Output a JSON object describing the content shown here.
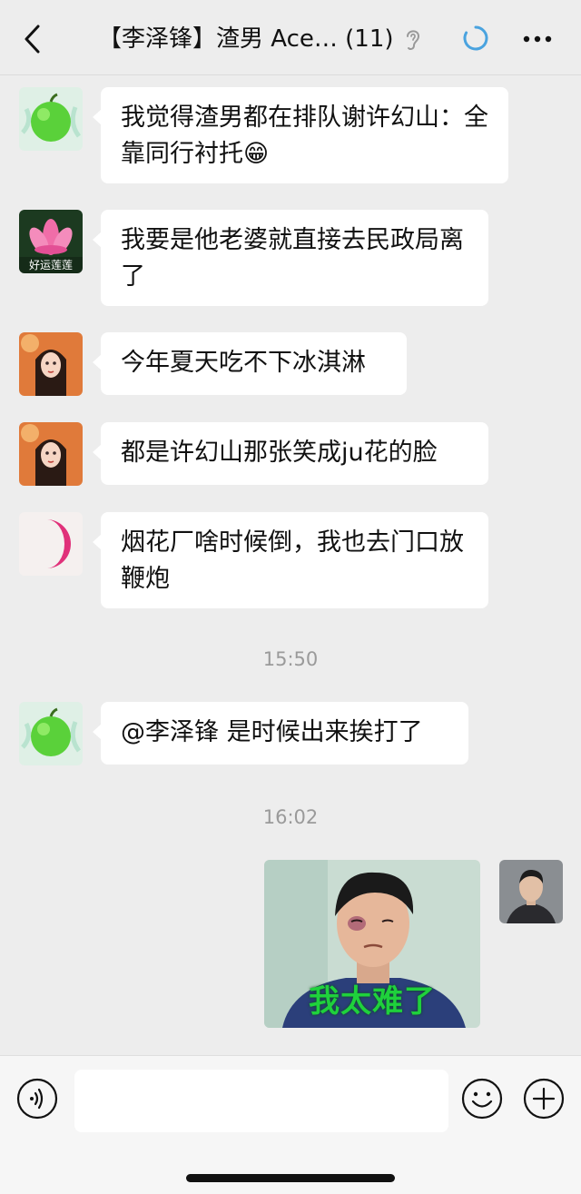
{
  "header": {
    "title": "【李泽锋】渣男 Ace… (11)",
    "icons": [
      "back-icon",
      "ear-icon",
      "sync-icon",
      "more-icon"
    ]
  },
  "messages": [
    {
      "sender_avatar": "green-apple-avatar",
      "text": "我觉得渣男都在排队谢许幻山：全靠同行衬托😁"
    },
    {
      "sender_avatar": "lotus-avatar",
      "avatar_caption": "好运莲莲",
      "text": "我要是他老婆就直接去民政局离了"
    },
    {
      "sender_avatar": "anime-girl-avatar",
      "text": "今年夏天吃不下冰淇淋"
    },
    {
      "sender_avatar": "anime-girl-avatar",
      "text": "都是许幻山那张笑成ju花的脸"
    },
    {
      "sender_avatar": "crescent-moon-avatar",
      "text": "烟花厂啥时候倒，我也去门口放鞭炮"
    },
    {
      "sender_avatar": "green-apple-avatar",
      "text": "@李泽锋 是时候出来挨打了"
    }
  ],
  "timestamps": [
    "15:50",
    "16:02"
  ],
  "sent_image": {
    "caption": "我太难了",
    "sender_avatar": "man-portrait-avatar"
  },
  "input_bar": {
    "placeholder": "",
    "icons": [
      "voice-icon",
      "emoji-icon",
      "plus-icon"
    ]
  },
  "colors": {
    "background": "#ededed",
    "bubble": "#ffffff",
    "accent_blue": "#4aa3df",
    "sticker_caption": "#1fd13c"
  }
}
